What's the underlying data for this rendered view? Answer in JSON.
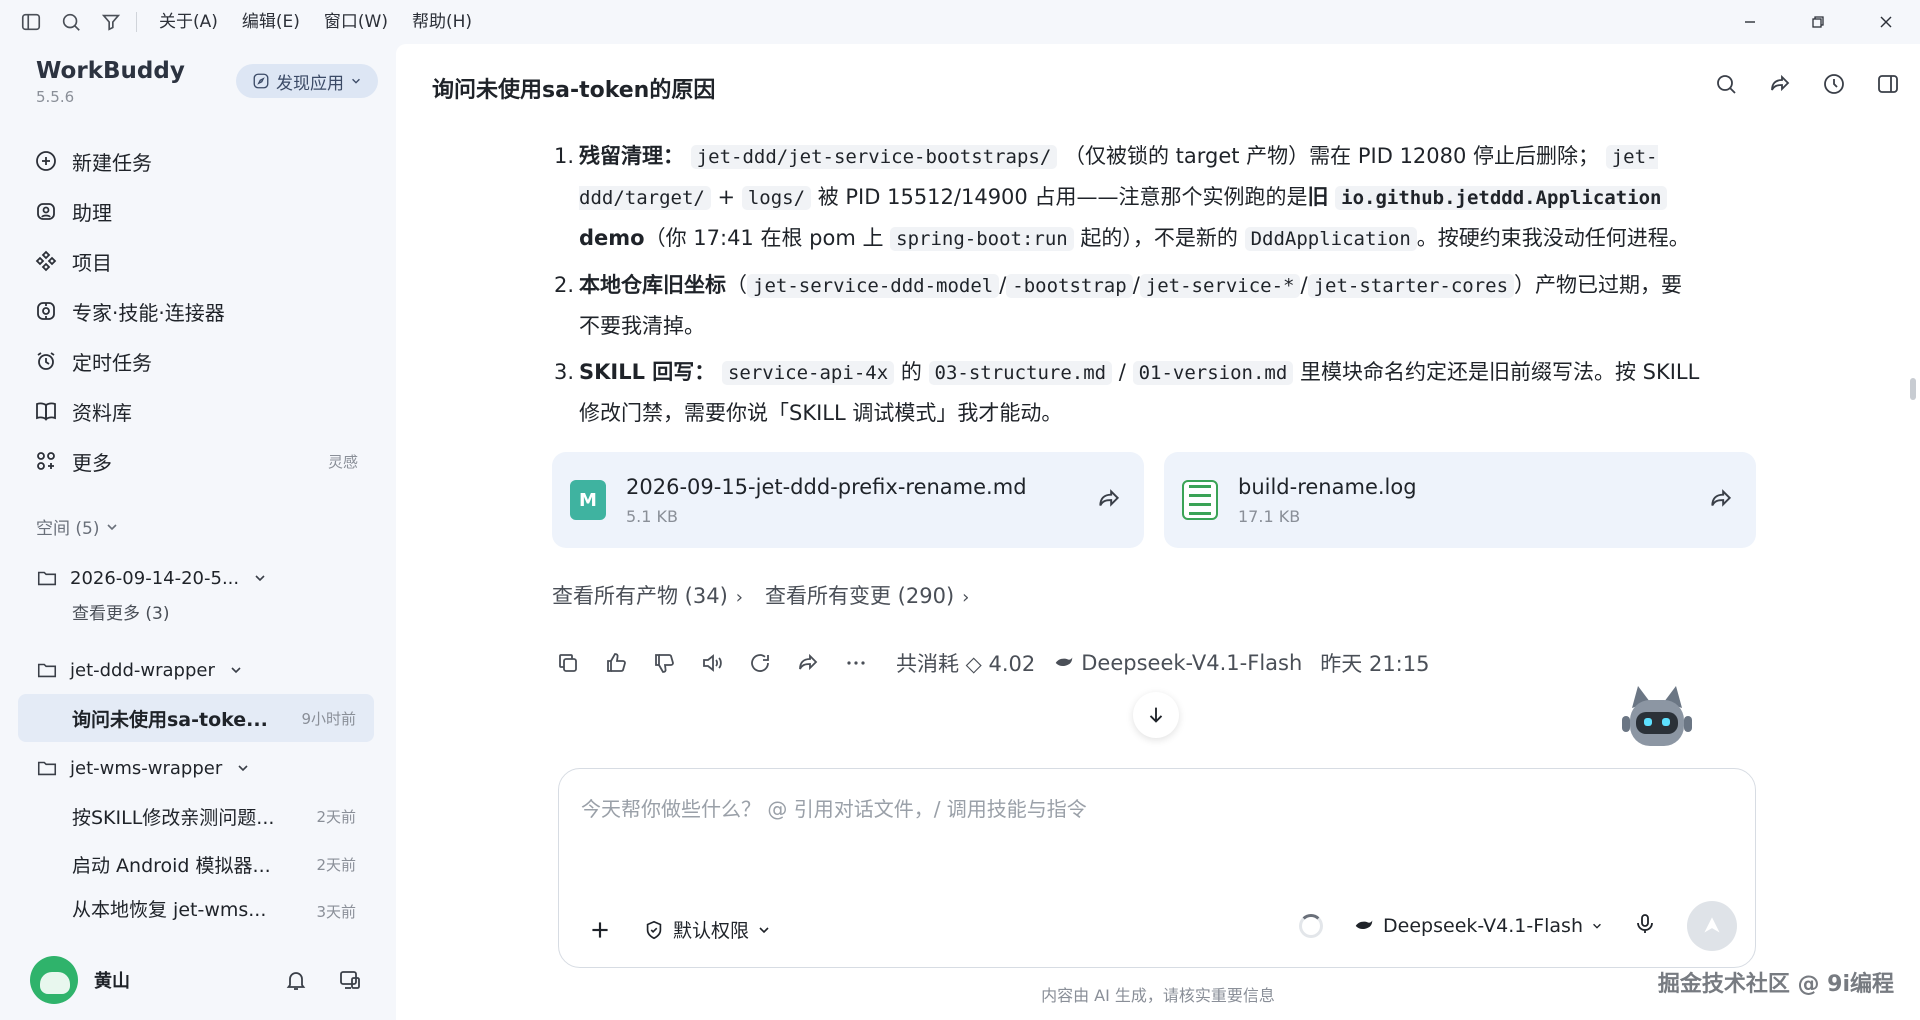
{
  "menu": {
    "items": [
      "关于(A)",
      "编辑(E)",
      "窗口(W)",
      "帮助(H)"
    ]
  },
  "sidebar": {
    "brand": "WorkBuddy",
    "version": "5.5.6",
    "discover_label": "发现应用",
    "nav": [
      {
        "label": "新建任务",
        "icon": "plus-circle-icon"
      },
      {
        "label": "助理",
        "icon": "assistant-icon"
      },
      {
        "label": "项目",
        "icon": "project-icon"
      },
      {
        "label": "专家·技能·连接器",
        "icon": "expert-icon"
      },
      {
        "label": "定时任务",
        "icon": "alarm-icon"
      },
      {
        "label": "资料库",
        "icon": "book-icon"
      },
      {
        "label": "更多",
        "icon": "grid-icon",
        "hint": "灵感"
      }
    ],
    "space_label": "空间 (5)",
    "tree": {
      "folder1": "2026-09-14-20-5...",
      "folder1_more": "查看更多 (3)",
      "folder2": "jet-ddd-wrapper",
      "task_active": {
        "title": "询问未使用sa-toke...",
        "time": "9小时前"
      },
      "folder3": "jet-wms-wrapper",
      "tasks": [
        {
          "title": "按SKILL修改亲测问题...",
          "time": "2天前"
        },
        {
          "title": "启动 Android 模拟器...",
          "time": "2天前"
        },
        {
          "title": "从本地恢复 jet-wms...",
          "time": "3天前"
        }
      ]
    },
    "user": {
      "name": "黄山"
    }
  },
  "main": {
    "title": "询问未使用sa-token的原因",
    "items": {
      "i1": {
        "num": "1.",
        "bold": "残留清理：",
        "c1": "jet-ddd/jet-service-bootstraps/",
        "t1": "（仅被锁的 target 产物）需在 PID 12080 停止后删除；",
        "c2": "jet-ddd/target/",
        "t2": "+",
        "c3": "logs/",
        "t3": "被 PID 15512/14900 占用——注意那个实例跑的是",
        "b2": "旧",
        "c4": "io.github.jetddd.Application",
        "b3": "demo",
        "t4": "（你 17:41 在根 pom 上",
        "c5": "spring-boot:run",
        "t5": "起的），不是新的",
        "c6": "DddApplication",
        "t6": "。按硬约束我没动任何进程。"
      },
      "i2": {
        "num": "2.",
        "bold": "本地仓库旧坐标",
        "t1": "（",
        "c1": "jet-service-ddd-model",
        "s1": "/",
        "c2": "-bootstrap",
        "s2": "/",
        "c3": "jet-service-*",
        "s3": "/",
        "c4": "jet-starter-cores",
        "t2": "）产物已过期，要不要我清掉。"
      },
      "i3": {
        "num": "3.",
        "bold": "SKILL 回写：",
        "c1": "service-api-4x",
        "t1": "的",
        "c2": "03-structure.md",
        "t2": "/",
        "c3": "01-version.md",
        "t3": "里模块命名约定还是旧前缀写法。按 SKILL 修改门禁，需要你说「SKILL 调试模式」我才能动。"
      }
    },
    "files": [
      {
        "name": "2026-09-15-jet-ddd-prefix-rename.md",
        "size": "5.1 KB",
        "icon": "markdown-file-icon",
        "letter": "M"
      },
      {
        "name": "build-rename.log",
        "size": "17.1 KB",
        "icon": "log-file-icon"
      }
    ],
    "links": {
      "artifacts": "查看所有产物 (34)",
      "changes": "查看所有变更 (290)"
    },
    "meta": {
      "cost": "共消耗 ◇ 4.02",
      "model": "Deepseek-V4.1-Flash",
      "time": "昨天 21:15"
    },
    "input": {
      "placeholder": "今天帮你做些什么？ @ 引用对话文件，/ 调用技能与指令",
      "permission": "默认权限",
      "model": "Deepseek-V4.1-Flash"
    },
    "disclaimer": "内容由 AI 生成，请核实重要信息",
    "watermark": "掘金技术社区 @ 9i编程"
  }
}
